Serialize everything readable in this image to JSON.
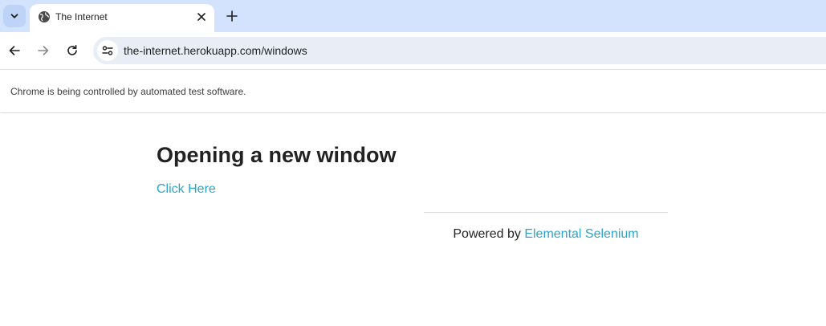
{
  "tab": {
    "title": "The Internet",
    "favicon": "globe-icon"
  },
  "toolbar": {
    "url": "the-internet.herokuapp.com/windows"
  },
  "infobar": {
    "message": "Chrome is being controlled by automated test software."
  },
  "page": {
    "heading": "Opening a new window",
    "link_text": "Click Here",
    "footer_prefix": "Powered by",
    "footer_link": "Elemental Selenium"
  },
  "colors": {
    "tabstrip": "#d3e3fd",
    "omnibox": "#e9eef6",
    "link": "#2ba6cb",
    "heading": "#222222"
  }
}
